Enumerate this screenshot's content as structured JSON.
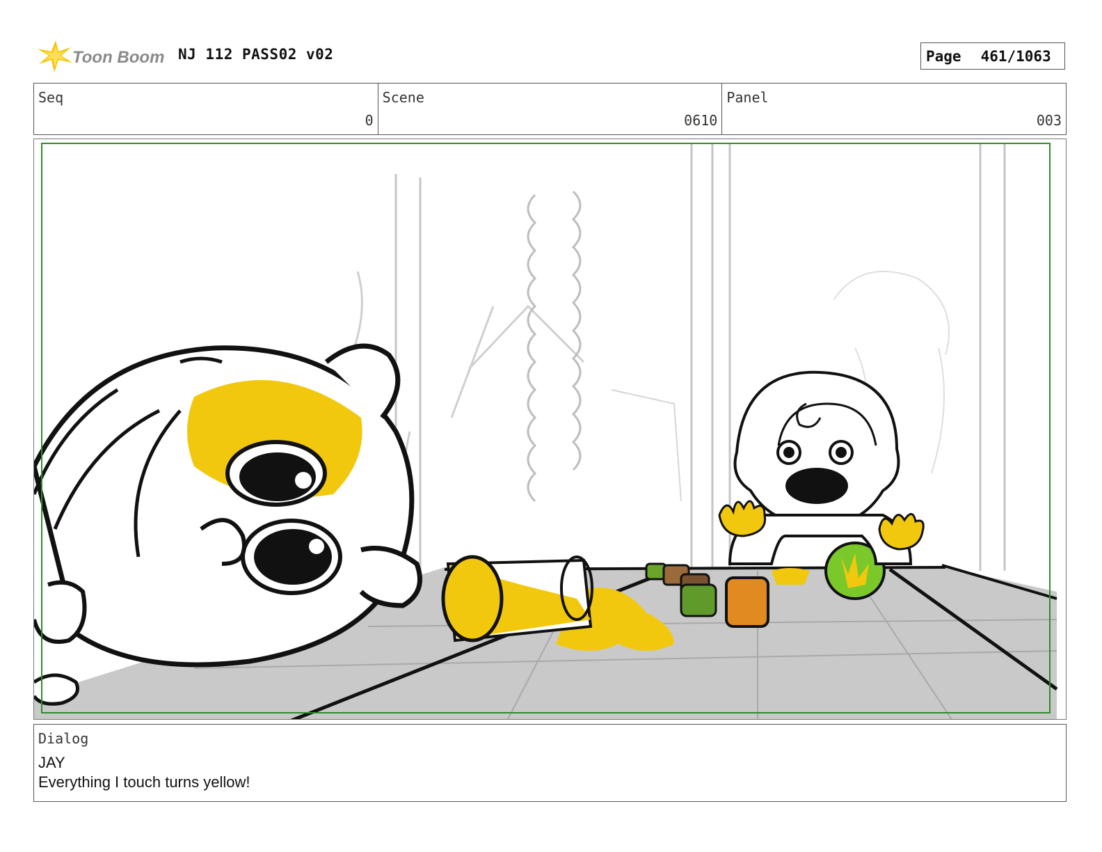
{
  "header": {
    "logo_text": "Toon Boom",
    "project_title": "NJ 112 PASS02 v02",
    "page_label": "Page",
    "page_number": "461/1063"
  },
  "info": {
    "seq_label": "Seq",
    "seq_value": "0",
    "scene_label": "Scene",
    "scene_value": "0610",
    "panel_label": "Panel",
    "panel_value": "003"
  },
  "panel": {
    "frame_color": "#2e8b2e",
    "accent_yellow": "#f2c80f"
  },
  "dialog": {
    "label": "Dialog",
    "character": "JAY",
    "line": "Everything I touch turns yellow!"
  }
}
